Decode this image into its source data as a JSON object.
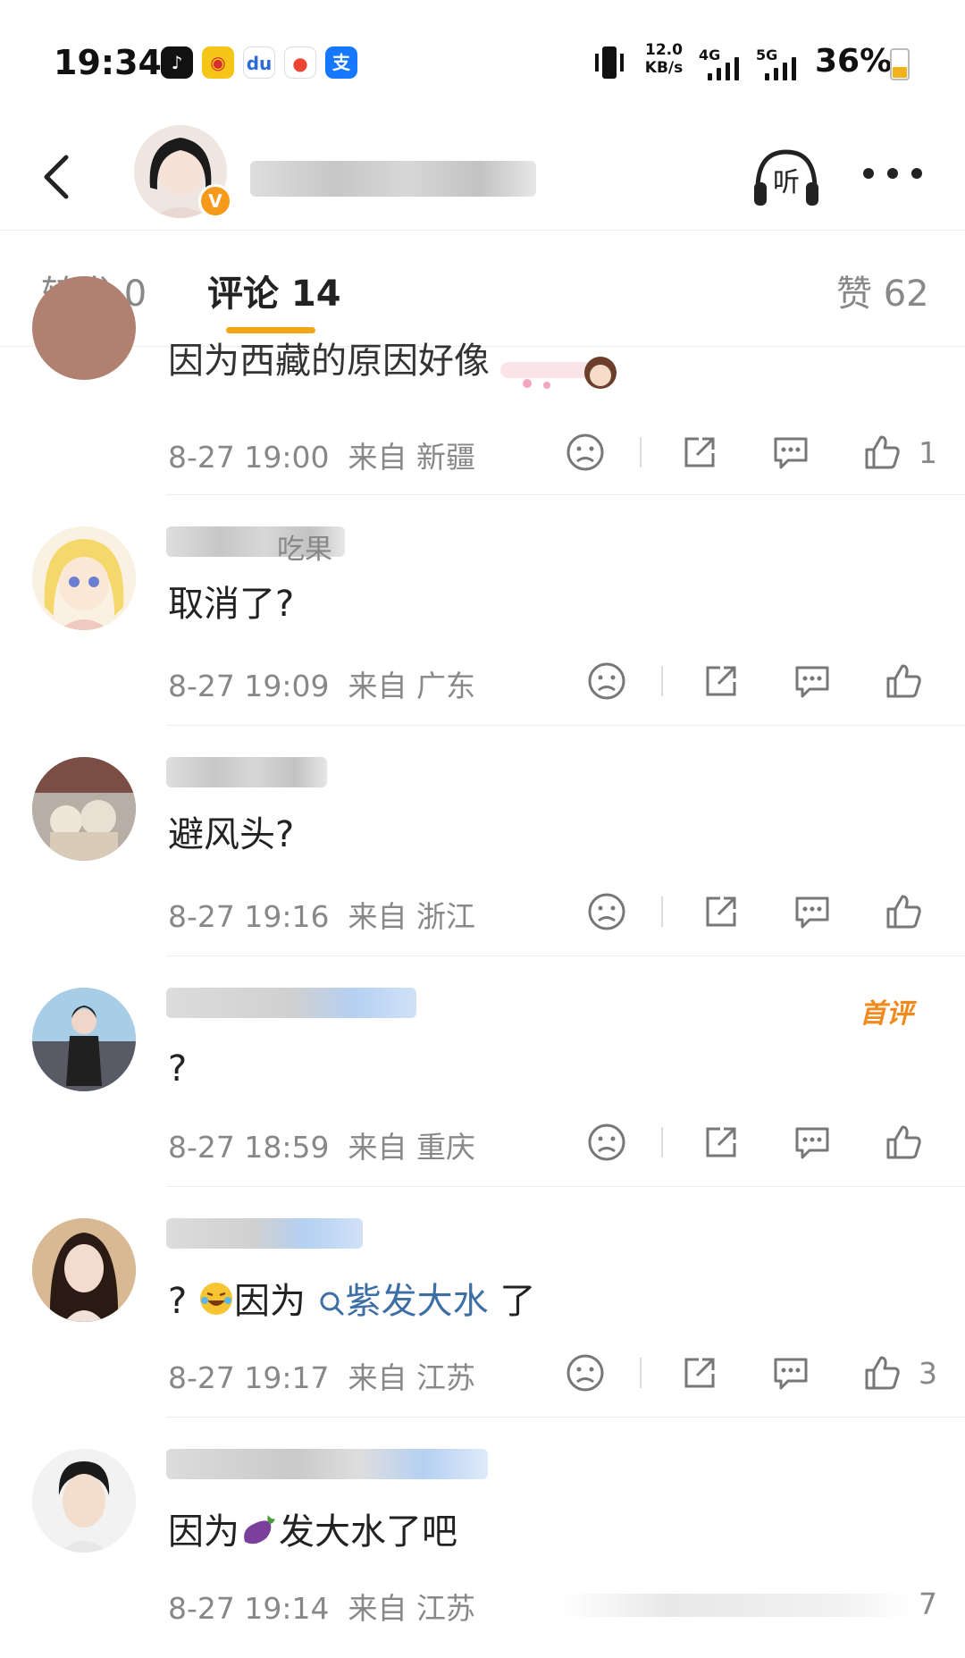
{
  "status_bar": {
    "time": "19:34",
    "net_speed_value": "12.0",
    "net_speed_unit": "KB/s",
    "signal_1": "4G",
    "signal_2": "5G",
    "battery_percent": "36%",
    "battery_level": 0.36
  },
  "header": {
    "verified_badge": "V",
    "listen_label": "听"
  },
  "tabs": {
    "repost": "转发 0",
    "comments": "评论 14",
    "likes": "赞 62"
  },
  "partial_comment": {
    "text": "因为西藏的原因好像",
    "date": "8-27 19:00",
    "from": "来自 新疆",
    "likes": "1"
  },
  "comments": [
    {
      "username_visible": "吃果",
      "text": "取消了?",
      "date": "8-27 19:09",
      "from": "来自 广东",
      "likes": ""
    },
    {
      "username_visible": "",
      "text": "避风头?",
      "date": "8-27 19:16",
      "from": "来自 浙江",
      "likes": ""
    },
    {
      "username_visible": "",
      "text": "?",
      "badge": "首评",
      "date": "8-27 18:59",
      "from": "来自 重庆",
      "likes": ""
    },
    {
      "username_visible": "",
      "text_prefix": "?",
      "text_mid": "因为",
      "topic": "紫发大水",
      "text_suffix": "了",
      "date": "8-27 19:17",
      "from": "来自 江苏",
      "likes": "3"
    },
    {
      "username_visible": "",
      "text_mid": "因为",
      "text_suffix": "发大水了吧",
      "date": "8-27 19:14",
      "from": "来自 江苏",
      "likes": "7"
    }
  ],
  "icons": {
    "colors": {
      "accent": "#f2a516",
      "topic_link": "#3d6ea6",
      "meta_text": "#888888",
      "first_badge": "#f08a1c"
    }
  }
}
